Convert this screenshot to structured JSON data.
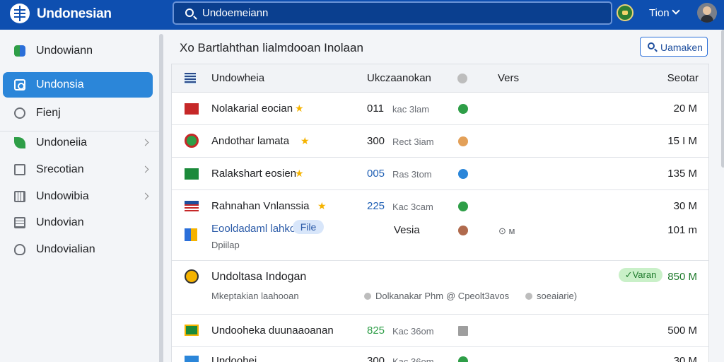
{
  "header": {
    "brand": "Undonesian",
    "search_text": "Undoemeiann",
    "user_label": "Tion"
  },
  "sidebar": {
    "items": [
      {
        "label": "Undowiann",
        "icon": "photos-icon"
      },
      {
        "label": "Undonsia",
        "icon": "square-icon",
        "active": true
      },
      {
        "label": "Fienj",
        "icon": "chat-icon"
      },
      {
        "label": "Undoneiia",
        "icon": "leaf-icon",
        "chevron": true
      },
      {
        "label": "Srecotian",
        "icon": "screen-icon",
        "chevron": true
      },
      {
        "label": "Undowibia",
        "icon": "grid-icon",
        "chevron": true
      },
      {
        "label": "Undovian",
        "icon": "doc-icon"
      },
      {
        "label": "Undovialian",
        "icon": "badge-icon"
      }
    ]
  },
  "main": {
    "title": "Xo Bartlahthan lialmdooan Inolaan",
    "action_button": "Uamaken",
    "columns": {
      "name": "Undowheia",
      "owner": "Ukczaanokan",
      "status": "Vers",
      "size": "Seotar"
    },
    "rows": [
      {
        "name": "Nolakarial eocian",
        "num": "011",
        "tag": "kac 3lam",
        "size": "20 M",
        "star": true
      },
      {
        "name": "Andothar lamata",
        "num": "300",
        "tag": "Rect 3iam",
        "size": "15 I M",
        "star": true
      },
      {
        "name": "Ralakshart eosien",
        "num": "005",
        "tag": "Ras 3tom",
        "size": "135 M",
        "star": true
      },
      {
        "name": "Rahnahan Vnlanssia",
        "num": "225",
        "tag": "Kac 3cam",
        "size": "30 M",
        "star": true
      },
      {
        "name": "Eooldadaml lahko",
        "file_chip": "File",
        "sub": "Dpiilap",
        "extra": "Vesia",
        "small_label": "⊙ м",
        "size": "101 m"
      },
      {
        "name": "Undoltasa Indogan",
        "sub": "Mkeptakian laahooan",
        "badge": "✓Varan",
        "size": "850 M",
        "meta": [
          "Dolkanakar Phm",
          "@ Cpeolt3avos",
          "soeaiarie)"
        ]
      },
      {
        "name": "Undooheka duunaaoanan",
        "num": "825",
        "tag": "Kac 36om",
        "size": "500 M"
      },
      {
        "name": "Undoohei",
        "num": "300",
        "tag": "Kac 36om",
        "size": "30 M"
      }
    ]
  },
  "colors": {
    "topbar": "#0e4fb0",
    "accent": "#2b86d9",
    "star": "#f5b300",
    "green_dot": "#2e9e47",
    "orange_dot": "#e3a058",
    "blue_dot": "#2b86d9",
    "brown_dot": "#b06a4d",
    "gray_dot": "#9e9e9e"
  }
}
